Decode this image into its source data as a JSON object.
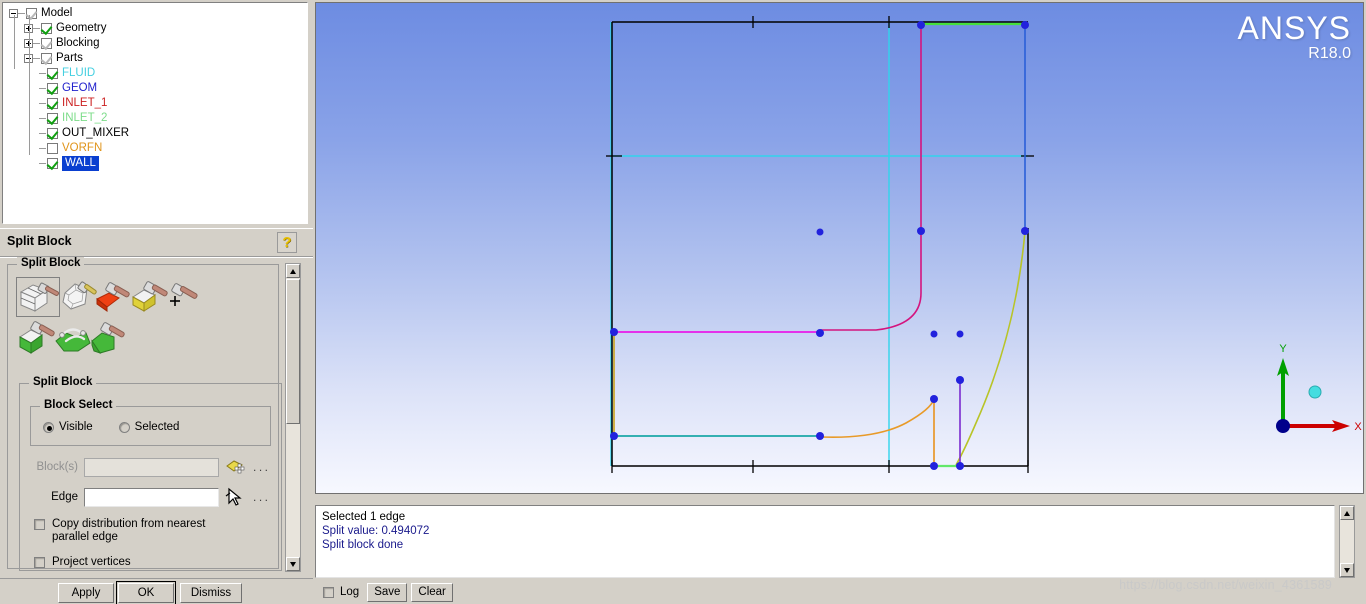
{
  "tree": {
    "nodes": [
      {
        "label": "Model",
        "depth": 0,
        "expander": "minus",
        "check": "faint",
        "color": "#000000"
      },
      {
        "label": "Geometry",
        "depth": 1,
        "expander": "plus",
        "check": "on",
        "color": "#000000"
      },
      {
        "label": "Blocking",
        "depth": 1,
        "expander": "plus",
        "check": "faint",
        "color": "#000000"
      },
      {
        "label": "Parts",
        "depth": 1,
        "expander": "minus",
        "check": "faint",
        "color": "#000000"
      },
      {
        "label": "FLUID",
        "depth": 2,
        "expander": "none",
        "check": "on",
        "color": "#44cfe0"
      },
      {
        "label": "GEOM",
        "depth": 2,
        "expander": "none",
        "check": "on",
        "color": "#2222cc"
      },
      {
        "label": "INLET_1",
        "depth": 2,
        "expander": "none",
        "check": "on",
        "color": "#cc2222"
      },
      {
        "label": "INLET_2",
        "depth": 2,
        "expander": "none",
        "check": "on",
        "color": "#7ddc8a"
      },
      {
        "label": "OUT_MIXER",
        "depth": 2,
        "expander": "none",
        "check": "on",
        "color": "#000000"
      },
      {
        "label": "VORFN",
        "depth": 2,
        "expander": "none",
        "check": "off",
        "color": "#e0941a"
      },
      {
        "label": "WALL",
        "depth": 2,
        "expander": "none",
        "check": "on",
        "color": "#ffffff",
        "selected": true
      }
    ]
  },
  "panel": {
    "title": "Split Block",
    "help_icon": "question-mark-icon",
    "group_outer_label": "Split Block",
    "group_inner_label": "Split Block",
    "block_select_label": "Block Select",
    "radios": [
      {
        "label": "Visible",
        "selected": true
      },
      {
        "label": "Selected",
        "selected": false
      }
    ],
    "fields": [
      {
        "label": "Block(s)",
        "value": "",
        "disabled": true,
        "picker": "select-blocks-icon",
        "dots": "..."
      },
      {
        "label": "Edge",
        "value": "",
        "disabled": false,
        "picker": "select-edge-cursor-icon",
        "dots": "..."
      }
    ],
    "checkboxes": [
      {
        "label": "Copy distribution from nearest parallel edge",
        "checked": false
      },
      {
        "label": "Project vertices",
        "checked": false
      }
    ],
    "icon_buttons": [
      {
        "name": "split-block-icon",
        "selected": true
      },
      {
        "name": "ogrid-block-icon",
        "selected": false
      },
      {
        "name": "split-face-icon",
        "selected": false
      },
      {
        "name": "split-vertices-icon",
        "selected": false
      },
      {
        "name": "extend-split-icon",
        "selected": false
      },
      {
        "name": "split-free-block-icon",
        "selected": false
      },
      {
        "name": "merge-split-block-icon",
        "selected": false
      },
      {
        "name": "split-2d-block-icon",
        "selected": false
      }
    ],
    "buttons": [
      {
        "label": "Apply",
        "focus": false
      },
      {
        "label": "OK",
        "focus": true
      },
      {
        "label": "Dismiss",
        "focus": false
      }
    ]
  },
  "viewport": {
    "logo_text": "ANSYS",
    "release": "R18.0",
    "triad": {
      "x_label": "X",
      "y_label": "Y",
      "x_color": "#cc0000",
      "y_color": "#00a000",
      "origin_color": "#0000aa",
      "z_dot_color": "#44dde0"
    },
    "background_top": "#6d8ce2",
    "background_bottom": "#f7f8ff"
  },
  "log": {
    "lines": [
      {
        "text": "Selected 1 edge",
        "color": "dark"
      },
      {
        "text": "Split value: 0.494072",
        "color": "blue"
      },
      {
        "text": "Split block done",
        "color": "blue"
      }
    ],
    "checkbox_label": "Log",
    "save_label": "Save",
    "clear_label": "Clear"
  },
  "watermark": "https://blog.csdn.net/weixin_4361589"
}
